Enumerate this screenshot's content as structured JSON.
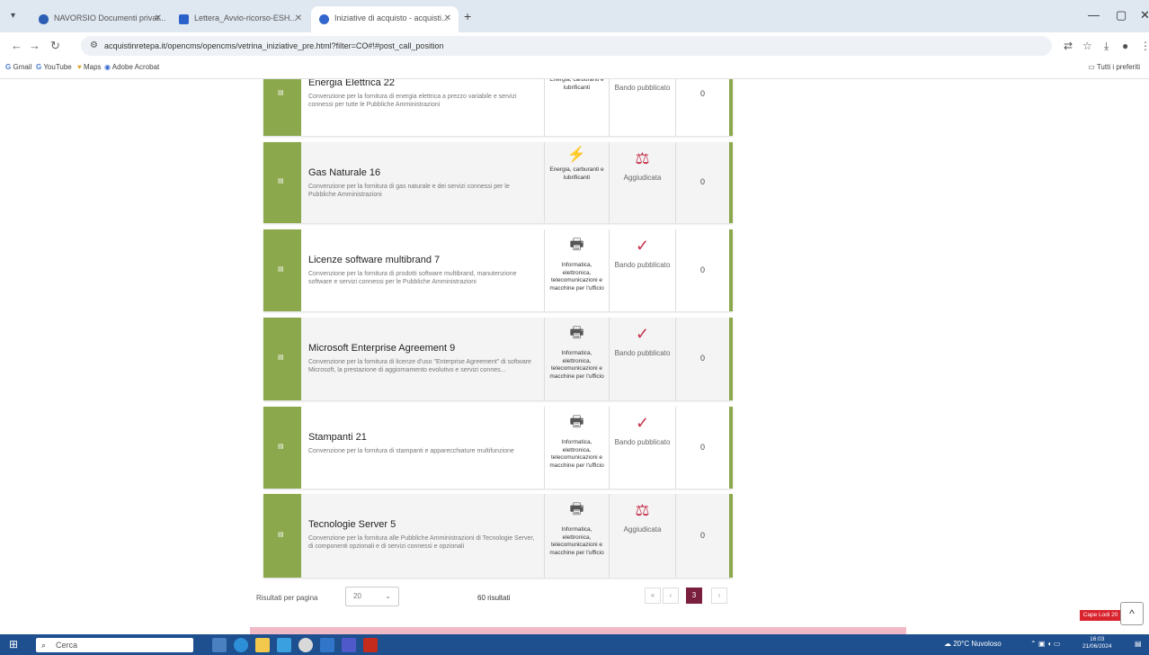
{
  "browser": {
    "tabs": [
      {
        "title": "NAVORSIO Documenti privat...",
        "color": "#2c5fb3"
      },
      {
        "title": "Lettera_Avvio-ricorso-ESH...",
        "color": "#2a62c9"
      },
      {
        "title": "Iniziative di acquisto - acquisti...",
        "color": "#3366cc"
      }
    ],
    "url": "acquistinretepa.it/opencms/opencms/vetrina_iniziative_pre.html?filter=CO#!#post_call_position",
    "bookmarks": [
      "Gmail",
      "YouTube",
      "Maps",
      "Adobe Acrobat"
    ],
    "bookmarks_right": "Tutti i preferiti"
  },
  "cards": [
    {
      "title": "Energia Elettrica 22",
      "desc": "Convenzione per la fornitura di energia elettrica a prezzo variabile e servizi connessi per tutte le Pubbliche Amministrazioni",
      "category": "Energia, carburanti e lubrificanti",
      "category_icon": "energy-icon",
      "status": "Bando pubblicato",
      "status_type": "published",
      "count": "0"
    },
    {
      "title": "Gas Naturale 16",
      "desc": "Convenzione per la fornitura di gas naturale e dei servizi connessi per le Pubbliche Amministrazioni",
      "category": "Energia, carburanti e lubrificanti",
      "category_icon": "energy-icon",
      "status": "Aggiudicata",
      "status_type": "awarded",
      "count": "0"
    },
    {
      "title": "Licenze software multibrand 7",
      "desc": "Convenzione per la fornitura di prodotti software multibrand, manutenzione software e servizi connessi per le Pubbliche Amministrazioni",
      "category": "Informatica, elettronica, telecomunicazioni e macchine per l'ufficio",
      "category_icon": "printer-icon",
      "status": "Bando pubblicato",
      "status_type": "published",
      "count": "0"
    },
    {
      "title": "Microsoft Enterprise Agreement 9",
      "desc": "Convenzione per la fornitura di licenze d'uso \"Enterprise Agreement\" di software Microsoft, la prestazione di aggiornamento evolutivo e servizi connes...",
      "category": "Informatica, elettronica, telecomunicazioni e macchine per l'ufficio",
      "category_icon": "printer-icon",
      "status": "Bando pubblicato",
      "status_type": "published",
      "count": "0"
    },
    {
      "title": "Stampanti 21",
      "desc": "Convenzione per la fornitura di stampanti e apparecchiature multifunzione",
      "category": "Informatica, elettronica, telecomunicazioni e macchine per l'ufficio",
      "category_icon": "printer-icon",
      "status": "Bando pubblicato",
      "status_type": "published",
      "count": "0"
    },
    {
      "title": "Tecnologie Server 5",
      "desc": "Convenzione per la fornitura alle Pubbliche Amministrazioni di Tecnologie Server, di componenti opzionali e di servizi connessi e opzionali",
      "category": "Informatica, elettronica, telecomunicazioni e macchine per l'ufficio",
      "category_icon": "printer-icon",
      "status": "Aggiudicata",
      "status_type": "awarded",
      "count": "0"
    }
  ],
  "pager": {
    "per_page_label": "Risultati per pagina",
    "per_page_value": "20",
    "results": "60 risultati",
    "current_page": "3"
  },
  "floating": {
    "badge": "Cape Lodi 20",
    "back_to_top": "^"
  },
  "taskbar": {
    "search_placeholder": "Cerca",
    "weather": "20°C Nuvoloso",
    "time": "16:03",
    "date": "21/06/2024"
  },
  "colors": {
    "accent_green": "#8ba84d",
    "awarded_red": "#c4314b",
    "published_check": "#c4314b",
    "pager_active": "#7a1f3d"
  }
}
